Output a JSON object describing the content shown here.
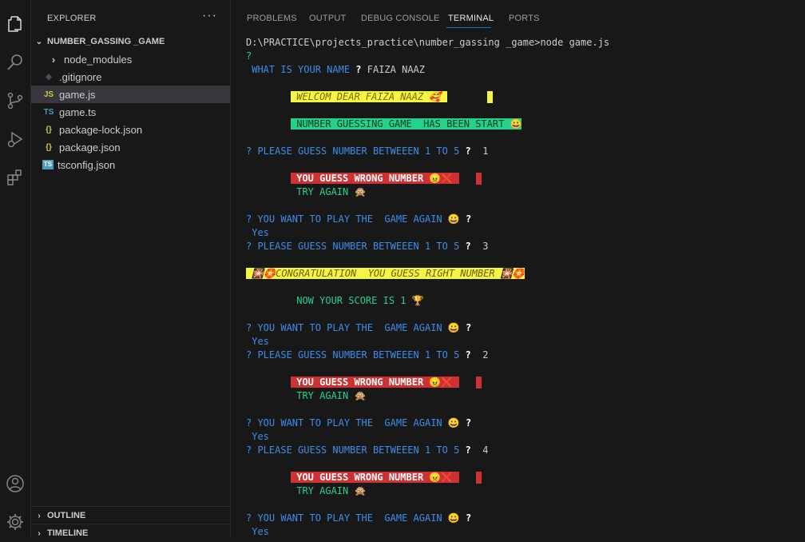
{
  "explorer": {
    "title": "EXPLORER",
    "more": "···",
    "folder": "NUMBER_GASSING _GAME",
    "items": [
      {
        "label": "node_modules",
        "icon": "›",
        "type": "folder"
      },
      {
        "label": ".gitignore",
        "icon": "◆",
        "type": "gitignore"
      },
      {
        "label": "game.js",
        "icon": "JS",
        "type": "js"
      },
      {
        "label": "game.ts",
        "icon": "TS",
        "type": "ts"
      },
      {
        "label": "package-lock.json",
        "icon": "{}",
        "type": "json"
      },
      {
        "label": "package.json",
        "icon": "{}",
        "type": "json"
      },
      {
        "label": "tsconfig.json",
        "icon": "TS",
        "type": "tsconfig"
      }
    ],
    "outline": "OUTLINE",
    "timeline": "TIMELINE"
  },
  "panel_tabs": [
    "PROBLEMS",
    "OUTPUT",
    "DEBUG CONSOLE",
    "TERMINAL",
    "PORTS"
  ],
  "terminal": {
    "command": "D:\\PRACTICE\\projects_practice\\number_gassing _game>node game.js",
    "q_mark": "?",
    "name_prompt": " WHAT IS YOUR NAME ",
    "name_answer": " FAIZA NAAZ",
    "welcome": " WELCOM DEAR FAIZA NAAZ 🥰 ",
    "start": " NUMBER GUESSING GAME  HAS BEEN START 😀",
    "guess_prompt": "? PLEASE GUESS NUMBER BETWEEEN 1 TO 5 ",
    "guesses": [
      "1",
      "3",
      "2",
      "4"
    ],
    "wrong": " YOU GUESS WRONG NUMBER 😠❌ ",
    "try_again": " TRY AGAIN 🙊",
    "play_again": "? YOU WANT TO PLAY THE  GAME AGAIN 😀 ",
    "yes": " Yes",
    "congrats": " 🎇🏵️CONGRATULATION  YOU GUESS RIGHT NUMBER 🎇🏵️",
    "score": " NOW YOUR SCORE IS 1 🏆"
  }
}
